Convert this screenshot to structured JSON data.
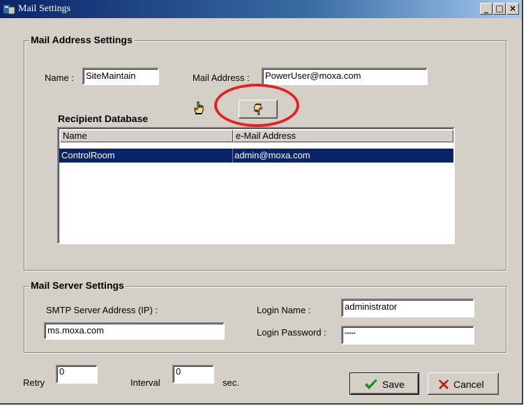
{
  "window": {
    "title": "Mail Settings",
    "controls": [
      "_",
      "□",
      "×"
    ]
  },
  "mail_address": {
    "legend": "Mail Address Settings",
    "name_label": "Name :",
    "name_value": "SiteMaintain",
    "address_label": "Mail Address :",
    "address_value": "PowerUser@moxa.com",
    "recipient_label": "Recipient Database",
    "columns": [
      "Name",
      "e-Mail Address"
    ],
    "rows": [
      {
        "name": "ControlRoom",
        "email": "admin@moxa.com",
        "selected": true
      }
    ]
  },
  "mail_server": {
    "legend": "Mail Server Settings",
    "smtp_label": "SMTP Server Address (IP) :",
    "smtp_value": "ms.moxa.com",
    "login_name_label": "Login Name :",
    "login_name_value": "administrator",
    "login_password_label": "Login Password :",
    "login_password_value": "*****"
  },
  "footer": {
    "retry_label": "Retry",
    "retry_value": "0",
    "interval_label": "Interval",
    "interval_value": "0",
    "interval_unit": "sec.",
    "save_label": "Save",
    "cancel_label": "Cancel"
  },
  "colors": {
    "titlebar": "#0a246a",
    "selection": "#0a246a",
    "highlight_oval": "#e8201e",
    "face": "#d4d0c8"
  },
  "icons": [
    "app-icon",
    "hand-up-icon",
    "hand-down-icon",
    "check-icon",
    "x-icon"
  ]
}
